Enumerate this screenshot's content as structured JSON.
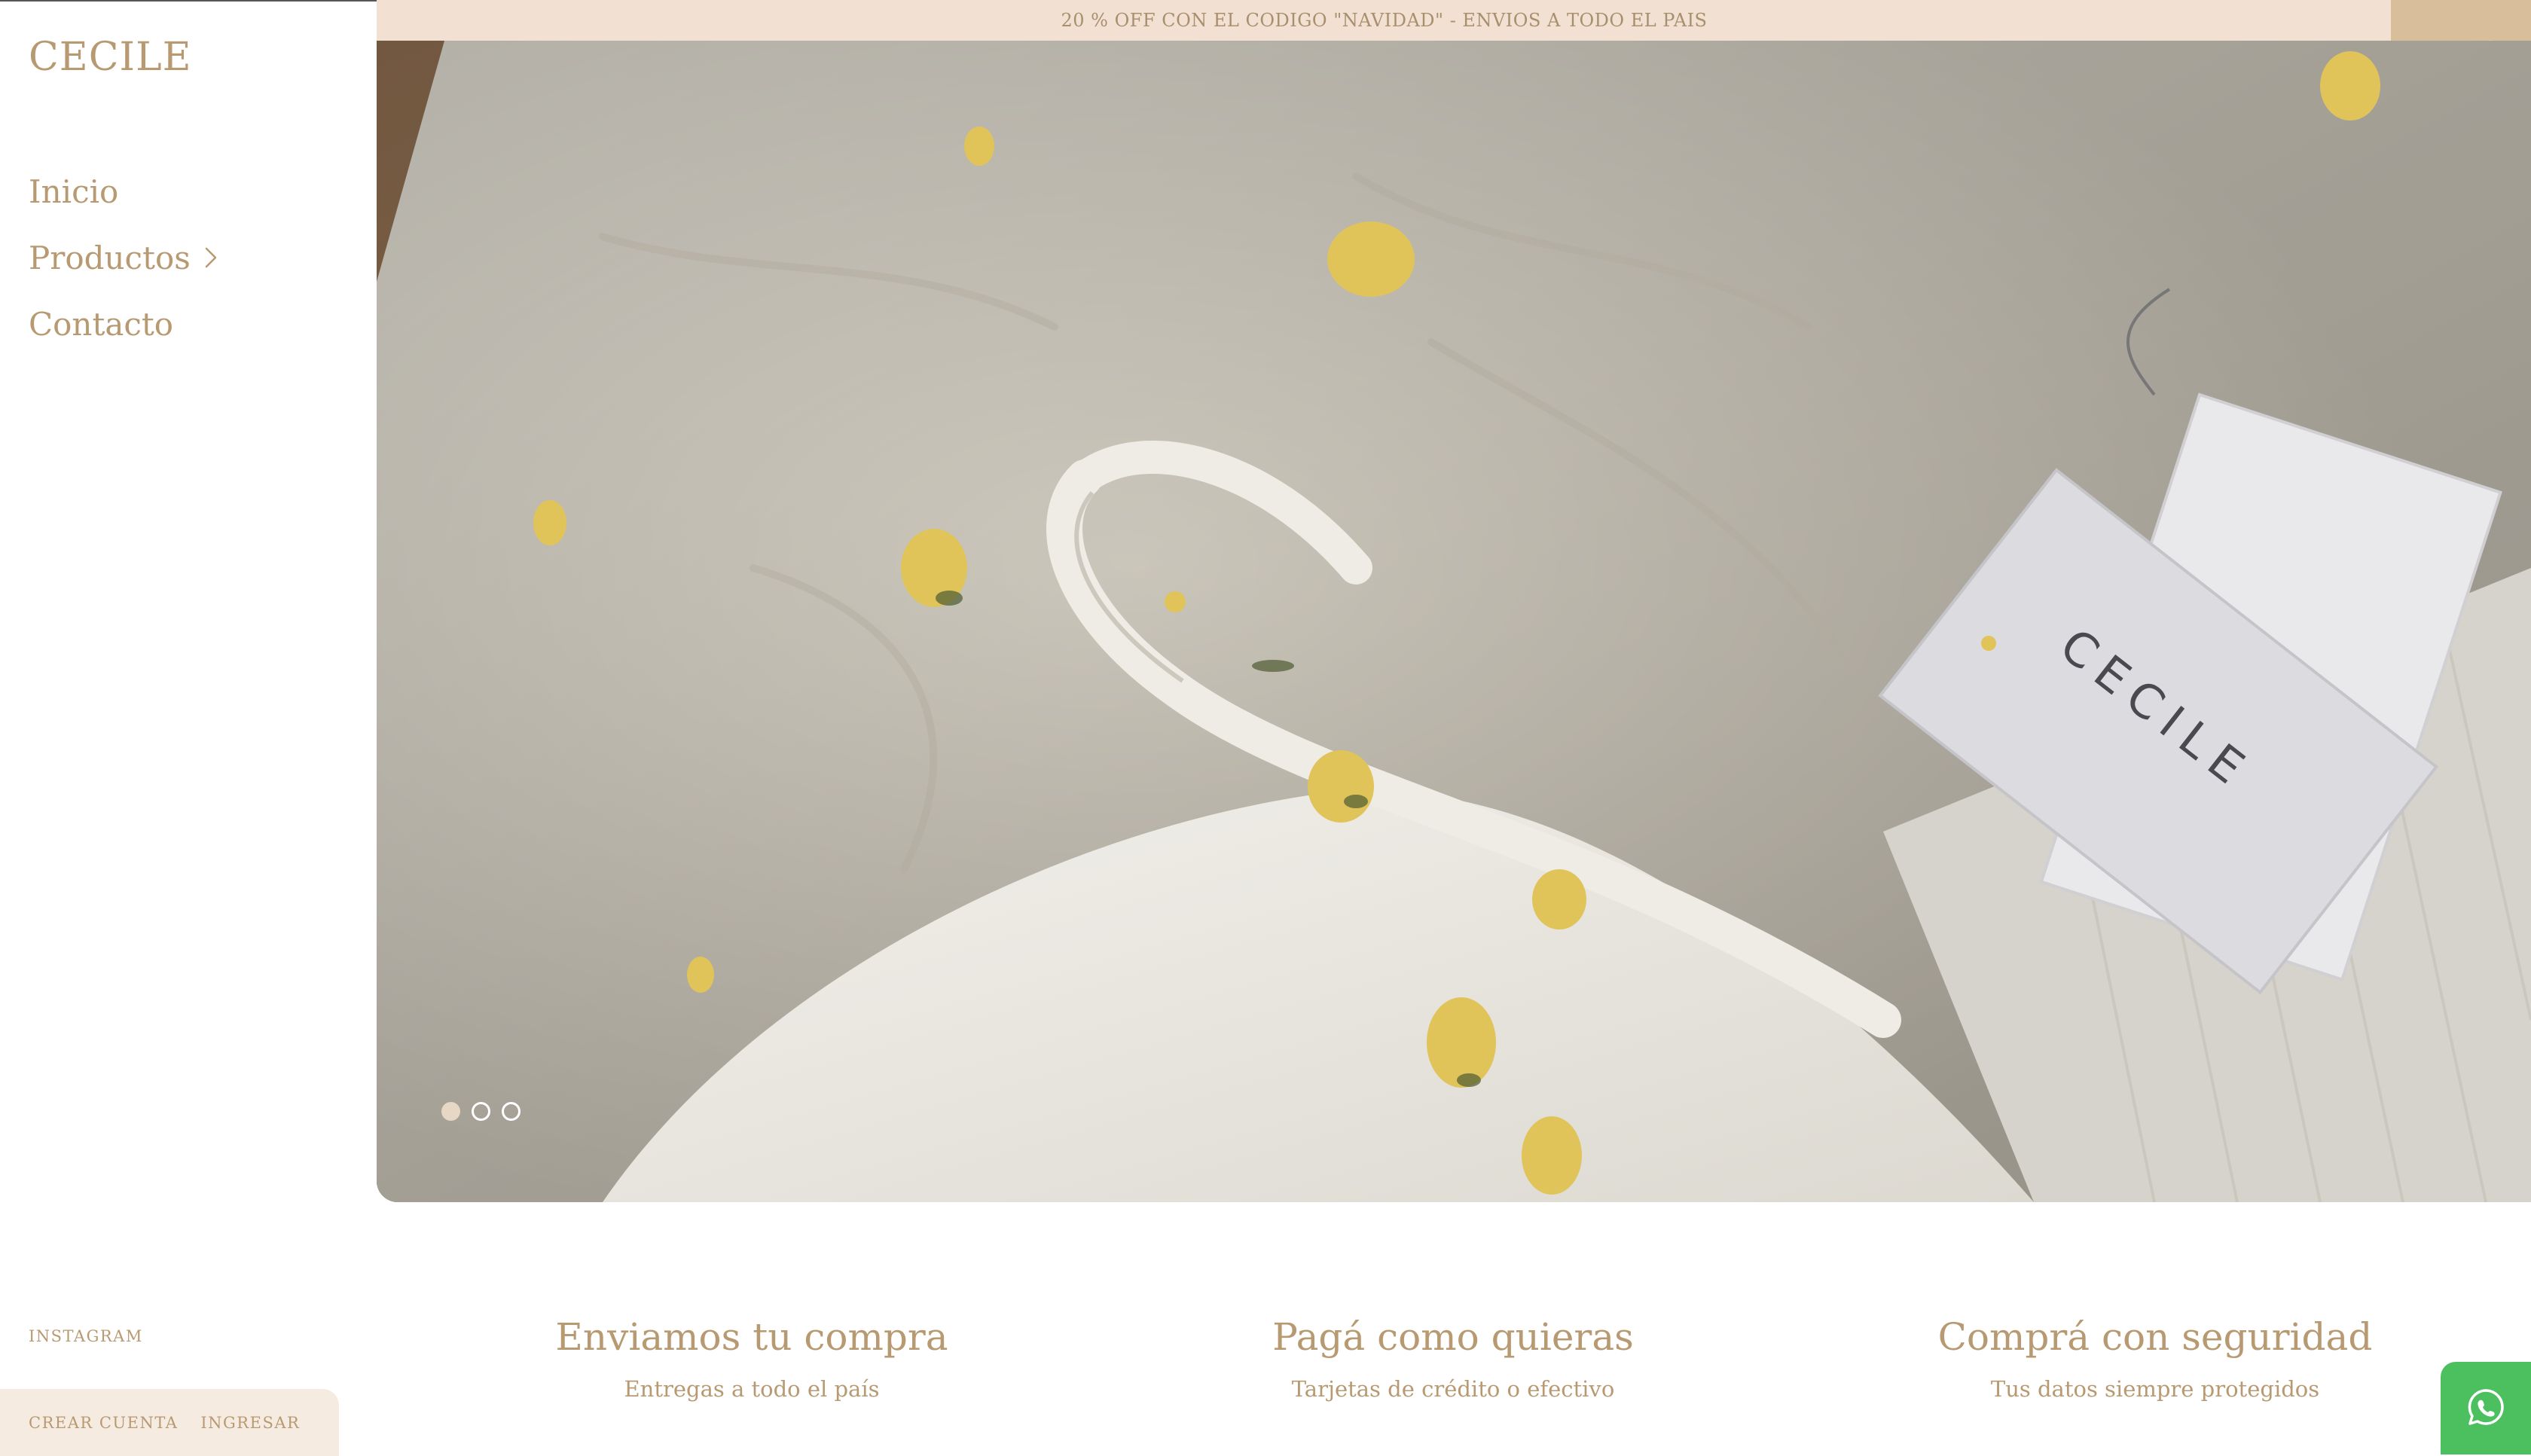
{
  "brand": {
    "logo": "CECILE",
    "accent_color": "#b89a72",
    "announce_bg": "#f2e1d2",
    "header_bg": "#d9be9b"
  },
  "announcement": "20 % OFF CON EL CODIGO \"NAVIDAD\" - ENVIOS A TODO EL PAIS",
  "nav": {
    "items": [
      {
        "label": "Inicio"
      },
      {
        "label": "Productos",
        "icon": "chevron-right-icon"
      },
      {
        "label": "Contacto"
      }
    ]
  },
  "sidebar_footer": {
    "instagram": "INSTAGRAM",
    "create_account": "CREAR CUENTA",
    "login": "INGRESAR"
  },
  "header": {
    "icons": [
      "search-icon",
      "shopping-bag-icon"
    ]
  },
  "hero": {
    "tag_text": "CECILE",
    "slides_total": 3,
    "active_slide": 1
  },
  "features": [
    {
      "title": "Enviamos tu compra",
      "subtitle": "Entregas a todo el país"
    },
    {
      "title": "Pagá como quieras",
      "subtitle": "Tarjetas de crédito o efectivo"
    },
    {
      "title": "Comprá con seguridad",
      "subtitle": "Tus datos siempre protegidos"
    }
  ],
  "whatsapp": {
    "icon": "whatsapp-icon",
    "color": "#4cc05e"
  }
}
